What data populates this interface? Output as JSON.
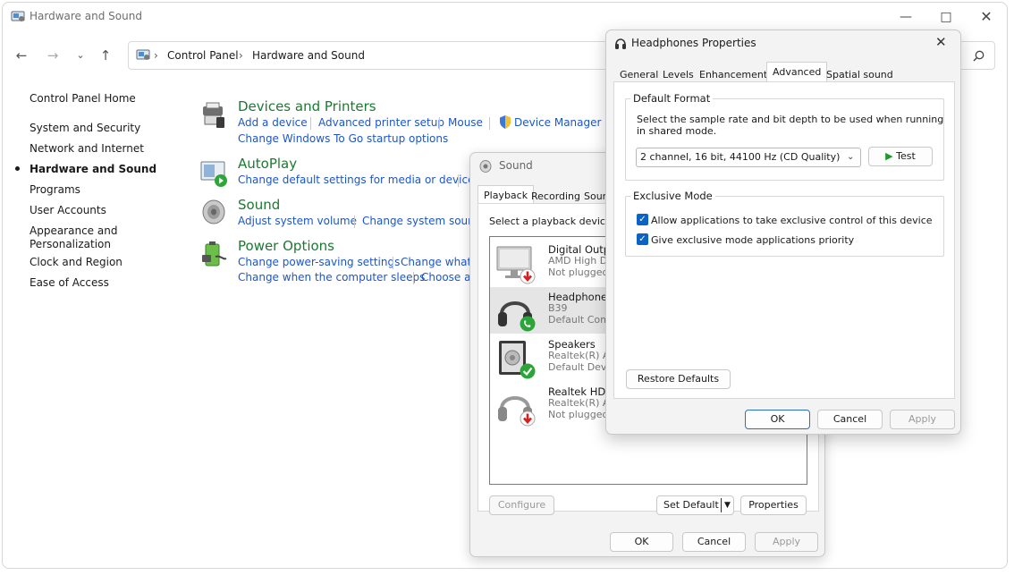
{
  "control_panel": {
    "window_title": "Hardware and Sound",
    "breadcrumb": [
      "Control Panel",
      "Hardware and Sound"
    ],
    "sidebar": [
      {
        "label": "Control Panel Home"
      },
      {
        "label": "System and Security"
      },
      {
        "label": "Network and Internet"
      },
      {
        "label": "Hardware and Sound",
        "active": true
      },
      {
        "label": "Programs"
      },
      {
        "label": "User Accounts"
      },
      {
        "label": "Appearance and Personalization"
      },
      {
        "label": "Clock and Region"
      },
      {
        "label": "Ease of Access"
      }
    ],
    "categories": {
      "devices": {
        "title": "Devices and Printers",
        "links": [
          "Add a device",
          "Advanced printer setup",
          "Mouse",
          "Device Manager",
          "Change Windows To Go startup options"
        ]
      },
      "autoplay": {
        "title": "AutoPlay",
        "links": [
          "Change default settings for media or devices"
        ]
      },
      "sound": {
        "title": "Sound",
        "links": [
          "Adjust system volume",
          "Change system sounds"
        ]
      },
      "power": {
        "title": "Power Options",
        "links": [
          "Change power-saving settings",
          "Change what t",
          "Change when the computer sleeps",
          "Choose a p"
        ]
      }
    }
  },
  "sound_dialog": {
    "title": "Sound",
    "tabs": [
      "Playback",
      "Recording",
      "Soun"
    ],
    "active_tab": "Playback",
    "instruction": "Select a playback device b",
    "devices": [
      {
        "name": "Digital Outp",
        "line1": "AMD High D",
        "line2": "Not plugged",
        "status_icon": "down-arrow-red-icon"
      },
      {
        "name": "Headphones",
        "line1": "B39",
        "line2": "Default Com",
        "status_icon": "phone-green-icon",
        "selected": true
      },
      {
        "name": "Speakers",
        "line1": "Realtek(R) Au",
        "line2": "Default Devic",
        "status_icon": "check-green-icon"
      },
      {
        "name": "Realtek HD A",
        "line1": "Realtek(R) Au",
        "line2": "Not plugged",
        "status_icon": "down-arrow-red-icon"
      }
    ],
    "buttons": {
      "configure": "Configure",
      "set_default": "Set Default",
      "properties": "Properties",
      "ok": "OK",
      "cancel": "Cancel",
      "apply": "Apply"
    }
  },
  "properties_dialog": {
    "title": "Headphones Properties",
    "tabs": [
      "General",
      "Levels",
      "Enhancements",
      "Advanced",
      "Spatial sound"
    ],
    "active_tab": "Advanced",
    "default_format": {
      "label": "Default Format",
      "description_line1": "Select the sample rate and bit depth to be used when running",
      "description_line2": "in shared mode.",
      "selected_format": "2 channel, 16 bit, 44100 Hz (CD Quality)",
      "test_label": "Test"
    },
    "exclusive_mode": {
      "label": "Exclusive Mode",
      "allow_exclusive": {
        "label": "Allow applications to take exclusive control of this device",
        "checked": true
      },
      "give_priority": {
        "label": "Give exclusive mode applications priority",
        "checked": true
      }
    },
    "buttons": {
      "restore_defaults": "Restore Defaults",
      "ok": "OK",
      "cancel": "Cancel",
      "apply": "Apply"
    }
  }
}
